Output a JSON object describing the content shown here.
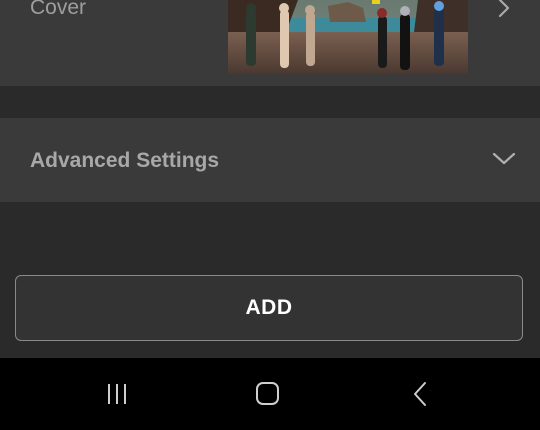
{
  "cover": {
    "label": "Cover",
    "chevron_icon": "chevron-right-icon"
  },
  "advanced": {
    "label": "Advanced Settings",
    "chevron_icon": "chevron-down-icon"
  },
  "add_button": {
    "label": "ADD"
  },
  "nav": {
    "recent_icon": "recent-apps-icon",
    "home_icon": "home-icon",
    "back_icon": "back-icon"
  },
  "colors": {
    "row_bg": "#3a3a3a",
    "page_bg": "#2a2a2a",
    "nav_bg": "#000000",
    "label_text": "#9e9e9e",
    "button_text": "#ffffff"
  }
}
